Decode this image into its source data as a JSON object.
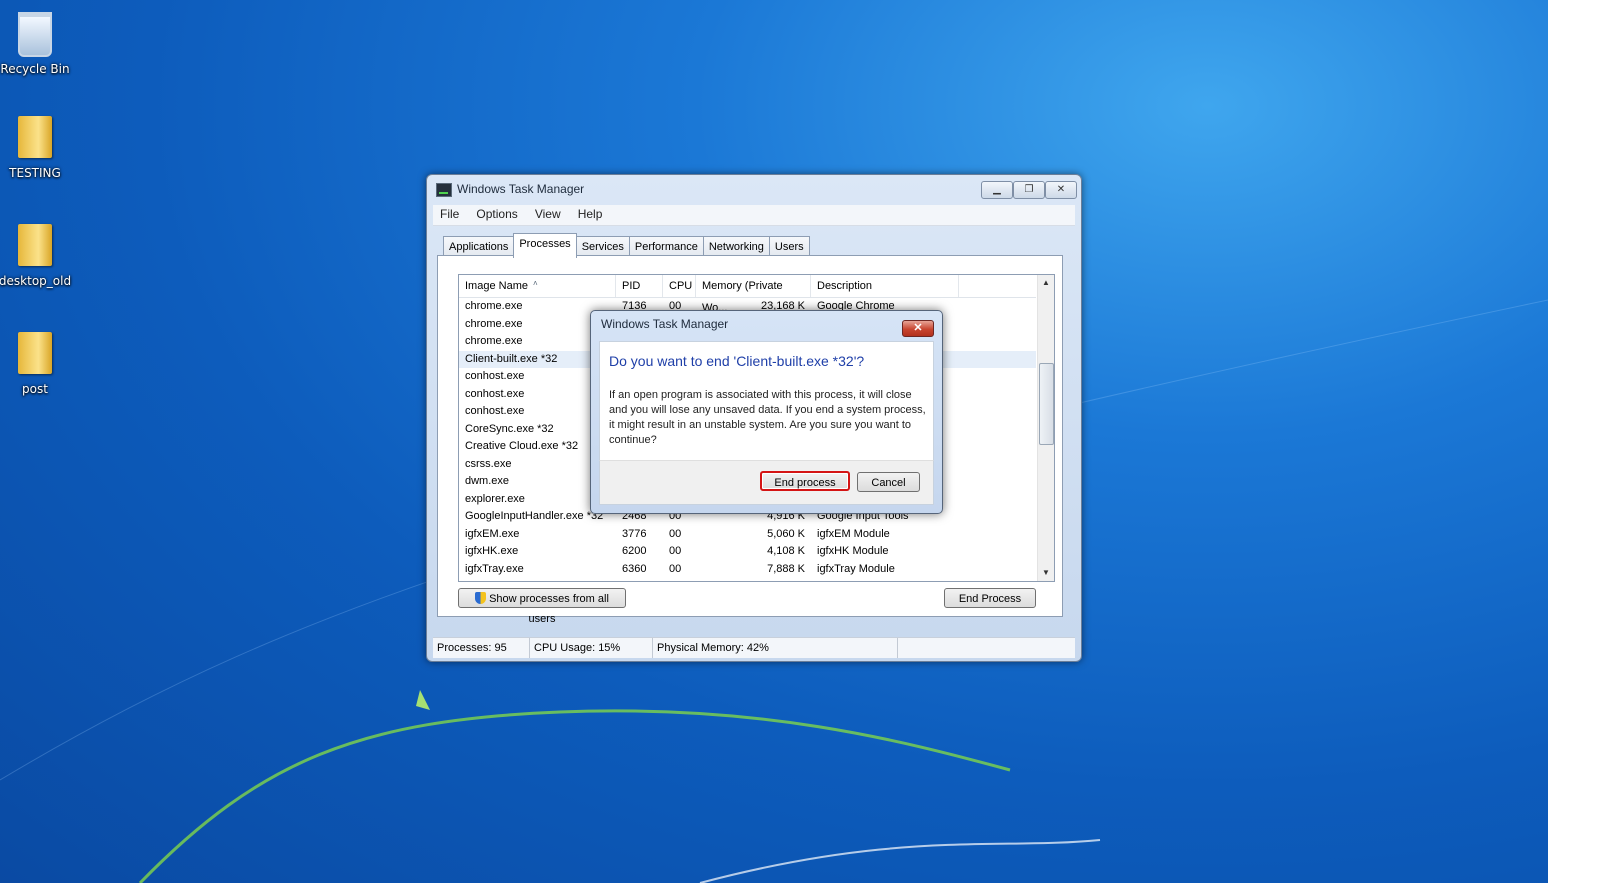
{
  "desktop": {
    "icons": [
      {
        "label": "Recycle Bin"
      },
      {
        "label": "TESTING"
      },
      {
        "label": "desktop_old"
      },
      {
        "label": "post"
      }
    ]
  },
  "task_manager": {
    "title": "Windows Task Manager",
    "window_buttons": {
      "minimize": "▁",
      "restore": "❐",
      "close": "✕"
    },
    "menu": [
      "File",
      "Options",
      "View",
      "Help"
    ],
    "tabs": [
      "Applications",
      "Processes",
      "Services",
      "Performance",
      "Networking",
      "Users"
    ],
    "active_tab": "Processes",
    "columns": [
      "Image Name",
      "PID",
      "CPU",
      "Memory (Private Wo...",
      "Description"
    ],
    "sort_indicator": "˄",
    "rows": [
      {
        "name": "chrome.exe",
        "pid": "7136",
        "cpu": "00",
        "memory": "23,168 K",
        "description": "Google Chrome"
      },
      {
        "name": "chrome.exe",
        "pid": "",
        "cpu": "",
        "memory": "",
        "description": ""
      },
      {
        "name": "chrome.exe",
        "pid": "",
        "cpu": "",
        "memory": "",
        "description": ""
      },
      {
        "name": "Client-built.exe *32",
        "pid": "",
        "cpu": "",
        "memory": "",
        "description": ""
      },
      {
        "name": "conhost.exe",
        "pid": "",
        "cpu": "",
        "memory": "",
        "description": ""
      },
      {
        "name": "conhost.exe",
        "pid": "",
        "cpu": "",
        "memory": "",
        "description": ""
      },
      {
        "name": "conhost.exe",
        "pid": "",
        "cpu": "",
        "memory": "",
        "description": ""
      },
      {
        "name": "CoreSync.exe *32",
        "pid": "",
        "cpu": "",
        "memory": "",
        "description": ""
      },
      {
        "name": "Creative Cloud.exe *32",
        "pid": "",
        "cpu": "",
        "memory": "",
        "description": ""
      },
      {
        "name": "csrss.exe",
        "pid": "",
        "cpu": "",
        "memory": "",
        "description": ""
      },
      {
        "name": "dwm.exe",
        "pid": "",
        "cpu": "",
        "memory": "",
        "description": ""
      },
      {
        "name": "explorer.exe",
        "pid": "",
        "cpu": "",
        "memory": "",
        "description": ""
      },
      {
        "name": "GoogleInputHandler.exe *32",
        "pid": "2468",
        "cpu": "00",
        "memory": "4,916 K",
        "description": "Google Input Tools"
      },
      {
        "name": "igfxEM.exe",
        "pid": "3776",
        "cpu": "00",
        "memory": "5,060 K",
        "description": "igfxEM Module"
      },
      {
        "name": "igfxHK.exe",
        "pid": "6200",
        "cpu": "00",
        "memory": "4,108 K",
        "description": "igfxHK Module"
      },
      {
        "name": "igfxTray.exe",
        "pid": "6360",
        "cpu": "00",
        "memory": "7,888 K",
        "description": "igfxTray Module"
      }
    ],
    "selected_row": "Client-built.exe *32",
    "scroll_up": "▲",
    "scroll_down": "▼",
    "show_all_label": "Show processes from all users",
    "end_process_label": "End Process",
    "status": {
      "processes": "Processes: 95",
      "cpu_usage": "CPU Usage: 15%",
      "physical_memory": "Physical Memory: 42%"
    }
  },
  "dialog": {
    "title": "Windows Task Manager",
    "close_glyph": "✕",
    "heading": "Do you want to end 'Client-built.exe *32'?",
    "message": "If an open program is associated with this process, it will close and you will lose any unsaved data. If you end a system process, it might result in an unstable system. Are you sure you want to continue?",
    "confirm_label": "End process",
    "cancel_label": "Cancel"
  },
  "colors": {
    "desktop_blue": "#1b78d6",
    "dialog_heading": "#1f3fa8",
    "highlight_border": "#d41414",
    "close_button": "#c84530"
  }
}
